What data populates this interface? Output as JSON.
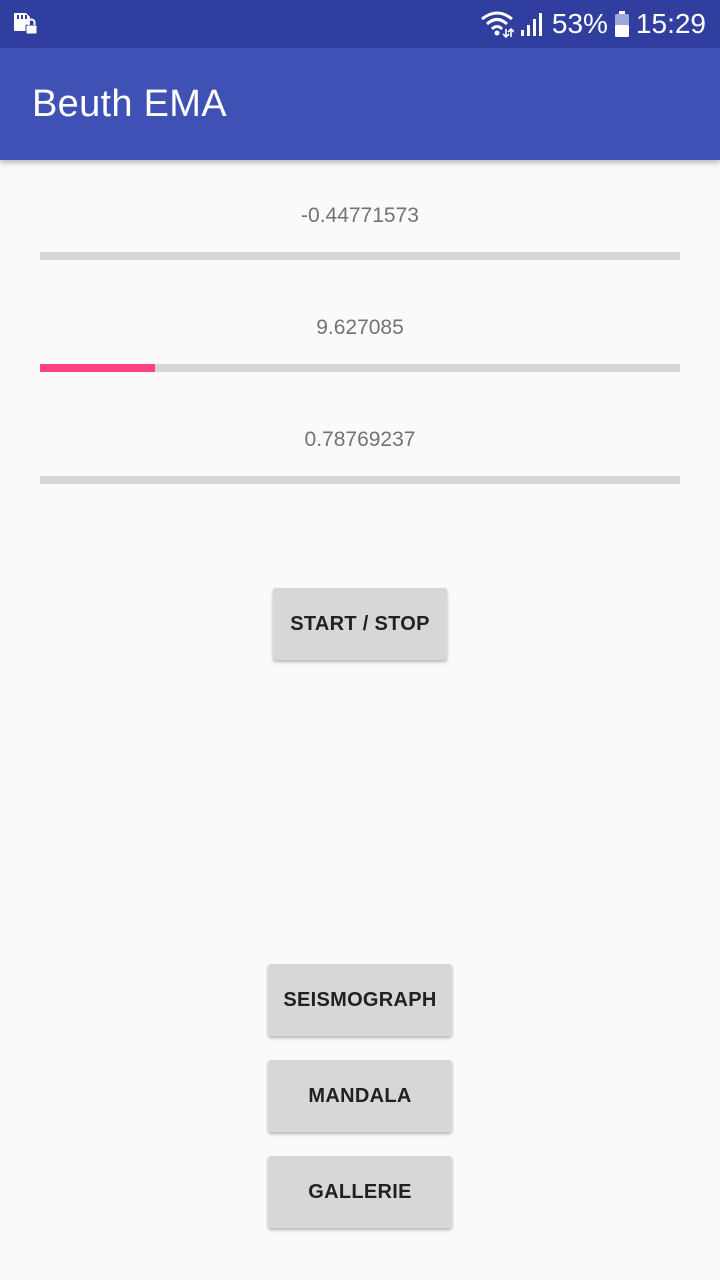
{
  "status_bar": {
    "battery_percent": "53%",
    "time": "15:29",
    "icons": [
      "sd-card-lock-icon",
      "wifi-icon",
      "signal-icon",
      "battery-icon"
    ],
    "background_color": "#303f9f"
  },
  "app_bar": {
    "title": "Beuth EMA",
    "background_color": "#3f51b5"
  },
  "sensors": [
    {
      "value": "-0.44771573",
      "progress_percent": 0
    },
    {
      "value": "9.627085",
      "progress_percent": 18
    },
    {
      "value": "0.78769237",
      "progress_percent": 0
    }
  ],
  "progress_colors": {
    "fill": "#ff4081",
    "track": "#d6d6d6"
  },
  "buttons": {
    "start_stop": "START / STOP",
    "seismograph": "SEISMOGRAPH",
    "mandala": "MANDALA",
    "gallerie": "GALLERIE"
  }
}
